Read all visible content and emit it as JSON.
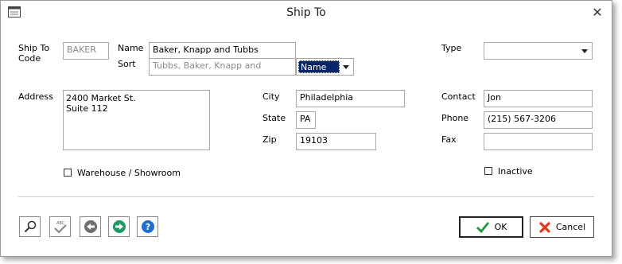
{
  "window": {
    "title": "Ship To"
  },
  "labels": {
    "ship_to_code": [
      "Ship To",
      "Code"
    ],
    "name": "Name",
    "sort": "Sort",
    "type": "Type",
    "address": "Address",
    "city": "City",
    "state": "State",
    "zip": "Zip",
    "contact": "Contact",
    "phone": "Phone",
    "fax": "Fax"
  },
  "fields": {
    "ship_to_code": "BAKER",
    "name": "Baker, Knapp and Tubbs",
    "sort": "Tubbs, Baker, Knapp and",
    "sort_mode": "Name",
    "type": "",
    "address_line1": "2400 Market St.",
    "address_line2": "Suite 112",
    "city": "Philadelphia",
    "state": "PA",
    "zip": "19103",
    "contact": "Jon",
    "phone": "(215) 567-3206",
    "fax": ""
  },
  "checkboxes": {
    "warehouse": {
      "label": "Warehouse / Showroom",
      "checked": false
    },
    "inactive": {
      "label": "Inactive",
      "checked": false
    }
  },
  "toolbar": {
    "icons": [
      "magnifier-icon",
      "spellcheck-icon",
      "back-icon",
      "forward-icon",
      "help-icon"
    ]
  },
  "buttons": {
    "ok": "OK",
    "cancel": "Cancel"
  }
}
